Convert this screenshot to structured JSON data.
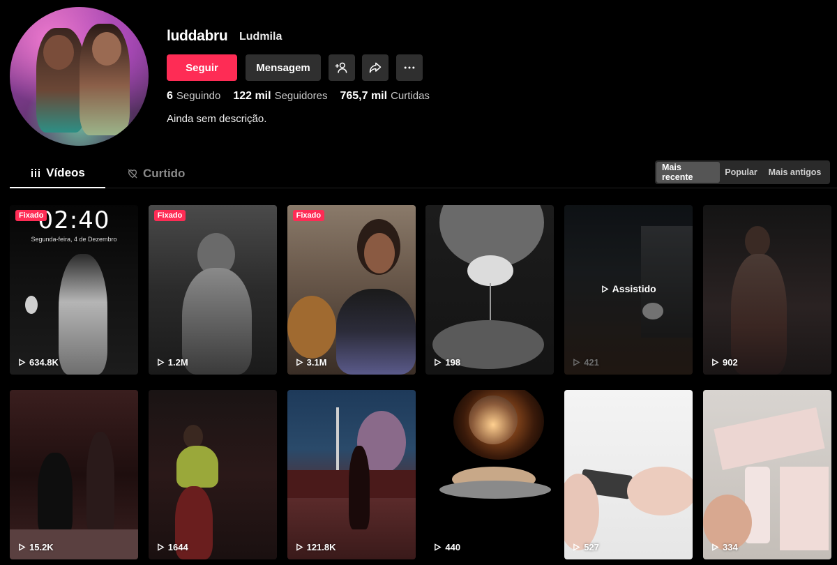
{
  "profile": {
    "username": "luddabru",
    "nickname": "Ludmila",
    "bio": "Ainda sem descrição."
  },
  "actions": {
    "follow_label": "Seguir",
    "message_label": "Mensagem",
    "add_friend_icon": "add-user-icon",
    "share_icon": "share-icon",
    "more_icon": "more-icon"
  },
  "stats": {
    "following_count": "6",
    "following_label": "Seguindo",
    "followers_count": "122 mil",
    "followers_label": "Seguidores",
    "likes_count": "765,7 mil",
    "likes_label": "Curtidas"
  },
  "tabs": {
    "videos_label": "Vídeos",
    "liked_label": "Curtido"
  },
  "sort": {
    "options": [
      "Mais recente",
      "Popular",
      "Mais antigos"
    ],
    "selected": "Mais recente"
  },
  "videos": [
    {
      "views": "634.8K",
      "pinned_label": "Fixado",
      "clock": "02:40",
      "clock_date": "Segunda-feira, 4 de Dezembro"
    },
    {
      "views": "1.2M",
      "pinned_label": "Fixado"
    },
    {
      "views": "3.1M",
      "pinned_label": "Fixado"
    },
    {
      "views": "198"
    },
    {
      "views": "421",
      "watched_label": "Assistido"
    },
    {
      "views": "902"
    },
    {
      "views": "15.2K"
    },
    {
      "views": "1644"
    },
    {
      "views": "121.8K"
    },
    {
      "views": "440"
    },
    {
      "views": "527"
    },
    {
      "views": "334"
    }
  ],
  "colors": {
    "accent": "#fe2c55",
    "button_dark": "#2f2f2f",
    "background": "#000000"
  }
}
